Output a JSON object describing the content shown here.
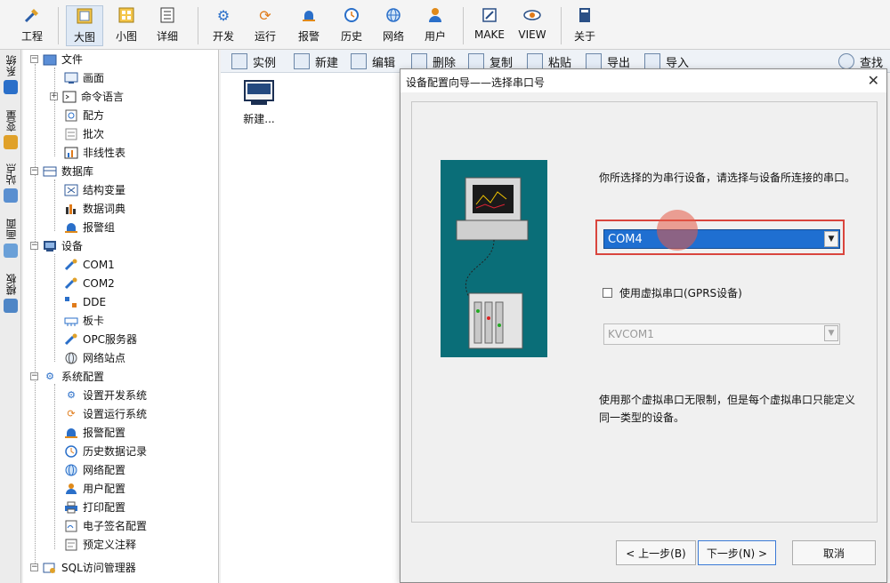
{
  "toolbar": {
    "items": [
      {
        "label": "工程",
        "icon": "tools-icon"
      },
      {
        "label": "大图",
        "icon": "large-icons-icon"
      },
      {
        "label": "小图",
        "icon": "small-icons-icon"
      },
      {
        "label": "详细",
        "icon": "details-icon"
      },
      {
        "label": "开发",
        "icon": "gear-icon"
      },
      {
        "label": "运行",
        "icon": "run-icon"
      },
      {
        "label": "报警",
        "icon": "bell-icon"
      },
      {
        "label": "历史",
        "icon": "clock-icon"
      },
      {
        "label": "网络",
        "icon": "globe-icon"
      },
      {
        "label": "用户",
        "icon": "user-icon"
      },
      {
        "label": "MAKE",
        "icon": "pen-icon"
      },
      {
        "label": "VIEW",
        "icon": "eye-icon"
      },
      {
        "label": "关于",
        "icon": "book-icon"
      }
    ]
  },
  "vtabs": [
    "系统",
    "变量",
    "站点",
    "画面",
    "模板"
  ],
  "tree": {
    "items": [
      {
        "label": "文件",
        "level": 0,
        "expander": "−",
        "icon": "folder-icon"
      },
      {
        "label": "画面",
        "level": 1,
        "icon": "screen-icon"
      },
      {
        "label": "命令语言",
        "level": 1,
        "expander": "+",
        "icon": "command-icon"
      },
      {
        "label": "配方",
        "level": 1,
        "icon": "recipe-icon"
      },
      {
        "label": "批次",
        "level": 1,
        "icon": "batch-icon"
      },
      {
        "label": "非线性表",
        "level": 1,
        "icon": "chart-icon"
      },
      {
        "label": "数据库",
        "level": 0,
        "expander": "−",
        "icon": "database-icon"
      },
      {
        "label": "结构变量",
        "level": 1,
        "icon": "struct-icon"
      },
      {
        "label": "数据词典",
        "level": 1,
        "icon": "dictionary-icon"
      },
      {
        "label": "报警组",
        "level": 1,
        "icon": "alarm-group-icon"
      },
      {
        "label": "设备",
        "level": 0,
        "expander": "−",
        "icon": "device-icon"
      },
      {
        "label": "COM1",
        "level": 1,
        "icon": "serial-port-icon"
      },
      {
        "label": "COM2",
        "level": 1,
        "icon": "serial-port-icon"
      },
      {
        "label": "DDE",
        "level": 1,
        "icon": "dde-icon"
      },
      {
        "label": "板卡",
        "level": 1,
        "icon": "board-icon"
      },
      {
        "label": "OPC服务器",
        "level": 1,
        "icon": "opc-icon"
      },
      {
        "label": "网络站点",
        "level": 1,
        "icon": "network-icon"
      },
      {
        "label": "系统配置",
        "level": 0,
        "expander": "−",
        "icon": "settings-icon"
      },
      {
        "label": "设置开发系统",
        "level": 1,
        "icon": "dev-settings-icon"
      },
      {
        "label": "设置运行系统",
        "level": 1,
        "icon": "run-settings-icon"
      },
      {
        "label": "报警配置",
        "level": 1,
        "icon": "bell-icon"
      },
      {
        "label": "历史数据记录",
        "level": 1,
        "icon": "history-icon"
      },
      {
        "label": "网络配置",
        "level": 1,
        "icon": "globe-icon"
      },
      {
        "label": "用户配置",
        "level": 1,
        "icon": "user-icon"
      },
      {
        "label": "打印配置",
        "level": 1,
        "icon": "printer-icon"
      },
      {
        "label": "电子签名配置",
        "level": 1,
        "icon": "signature-icon"
      },
      {
        "label": "预定义注释",
        "level": 1,
        "icon": "note-icon"
      },
      {
        "label": "SQL访问管理器",
        "level": 0,
        "expander": "−",
        "icon": "sql-icon"
      }
    ]
  },
  "content": {
    "toolbar": [
      "实例",
      "新建",
      "编辑",
      "删除",
      "复制",
      "粘贴",
      "导出",
      "导入",
      "查找"
    ],
    "file_item_label": "新建..."
  },
  "dialog": {
    "title": "设备配置向导——选择串口号",
    "description": "你所选择的为串行设备，请选择与设备所连接的串口。",
    "selected_port": "COM4",
    "virtual_port_checkbox": "使用虚拟串口(GPRS设备)",
    "virtual_port_checked": false,
    "virtual_port_value": "KVCOM1",
    "note": "使用那个虚拟串口无限制，但是每个虚拟串口只能定义同一类型的设备。",
    "buttons": {
      "prev": "< 上一步(B)",
      "next": "下一步(N) >",
      "cancel": "取消"
    }
  },
  "colors": {
    "selection_blue": "#1f6fd1",
    "highlight_red": "#d9453d",
    "illustration_bg": "#0a6e78"
  }
}
